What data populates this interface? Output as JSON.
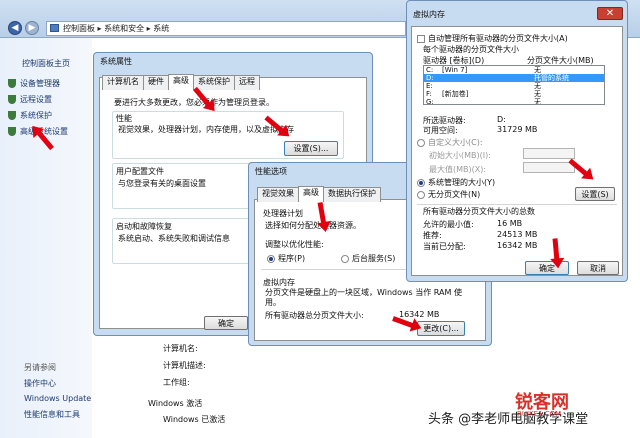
{
  "explorer": {
    "breadcrumb": [
      "控制面板",
      "系统和安全",
      "系统"
    ],
    "sidebar_home": "控制面板主页",
    "sidebar_items": [
      "设备管理器",
      "远程设置",
      "系统保护",
      "高级系统设置"
    ],
    "see_also_title": "另请参阅",
    "see_also": [
      "操作中心",
      "Windows Update",
      "性能信息和工具"
    ],
    "info_labels": [
      "计算机名:",
      "计算机描述:",
      "工作组:"
    ],
    "activation_title": "Windows 激活",
    "activation_status": "Windows 已激活"
  },
  "sysprops": {
    "title": "系统属性",
    "tabs": [
      "计算机名",
      "硬件",
      "高级",
      "系统保护",
      "远程"
    ],
    "admin_note": "要进行大多数更改，您必须作为管理员登录。",
    "perf_title": "性能",
    "perf_desc": "视觉效果，处理器计划，内存使用，以及虚拟内存",
    "perf_settings": "设置(S)...",
    "profile_title": "用户配置文件",
    "profile_desc": "与您登录有关的桌面设置",
    "startup_title": "启动和故障恢复",
    "startup_desc": "系统启动、系统失败和调试信息",
    "ok": "确定"
  },
  "perfopts": {
    "title": "性能选项",
    "tabs": [
      "视觉效果",
      "高级",
      "数据执行保护"
    ],
    "sched_title": "处理器计划",
    "sched_desc": "选择如何分配处理器资源。",
    "optimize_label": "调整以优化性能:",
    "opt_program": "程序(P)",
    "opt_service": "后台服务(S)",
    "vm_title": "虚拟内存",
    "vm_desc": "分页文件是硬盘上的一块区域，Windows 当作 RAM 使用。",
    "vm_total_label": "所有驱动器总分页文件大小:",
    "vm_total_value": "16342 MB",
    "change_button": "更改(C)..."
  },
  "vmem": {
    "title": "虚拟内存",
    "auto_manage": "自动管理所有驱动器的分页文件大小(A)",
    "per_drive": "每个驱动器的分页文件大小",
    "col_drive": "驱动器 [卷标](D)",
    "col_size": "分页文件大小(MB)",
    "drives": [
      {
        "drive": "C:",
        "label": "[Win 7]",
        "size": "无",
        "selected": false
      },
      {
        "drive": "D:",
        "label": "",
        "size": "托管的系统",
        "selected": true
      },
      {
        "drive": "E:",
        "label": "",
        "size": "无",
        "selected": false
      },
      {
        "drive": "F:",
        "label": "[新加卷]",
        "size": "无",
        "selected": false
      },
      {
        "drive": "G:",
        "label": "",
        "size": "无",
        "selected": false
      }
    ],
    "sel_drive_label": "所选驱动器:",
    "sel_drive_value": "D:",
    "free_label": "可用空间:",
    "free_value": "31729 MB",
    "custom": "自定义大小(C):",
    "initial": "初始大小(MB)(I):",
    "max": "最大值(MB)(X):",
    "system_managed": "系统管理的大小(Y)",
    "no_paging": "无分页文件(N)",
    "set_button": "设置(S)",
    "total_title": "所有驱动器分页文件大小的总数",
    "min_label": "允许的最小值:",
    "min_value": "16 MB",
    "rec_label": "推荐:",
    "rec_value": "24513 MB",
    "cur_label": "当前已分配:",
    "cur_value": "16342 MB",
    "ok": "确定",
    "cancel": "取消"
  },
  "watermark": {
    "text": "头条 @李老师电脑教学课堂",
    "logo": "锐客网",
    "logo_sub": "RUIKE1.COM"
  }
}
